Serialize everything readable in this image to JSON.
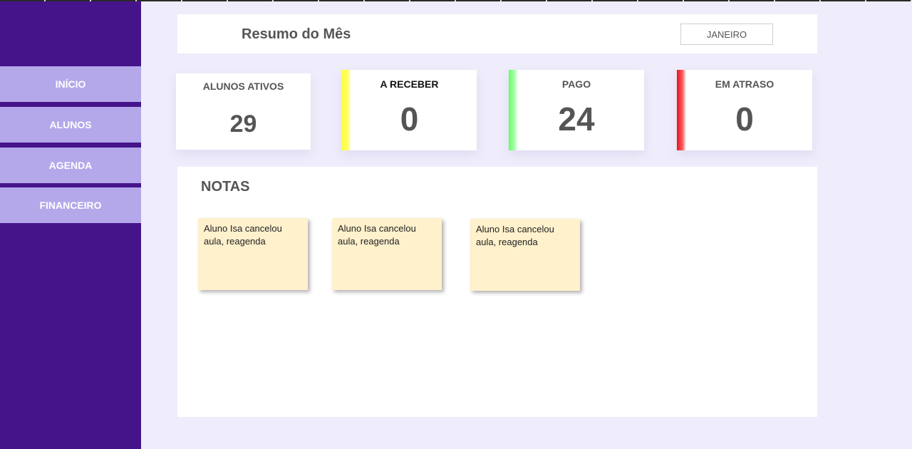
{
  "sidebar": {
    "items": [
      {
        "label": "INÍCIO"
      },
      {
        "label": "ALUNOS"
      },
      {
        "label": "AGENDA"
      },
      {
        "label": "FINANCEIRO"
      }
    ]
  },
  "header": {
    "title": "Resumo do Mês",
    "month": "JANEIRO"
  },
  "cards": [
    {
      "label": "ALUNOS ATIVOS",
      "value": "29"
    },
    {
      "label": "A RECEBER",
      "value": "0",
      "accent": "#ffff33"
    },
    {
      "label": "PAGO",
      "value": "24",
      "accent": "#7dff7d"
    },
    {
      "label": "EM ATRASO",
      "value": "0",
      "accent": "#e8141c"
    }
  ],
  "notes": {
    "title": "NOTAS",
    "items": [
      {
        "text": "Aluno Isa cancelou aula, reagenda"
      },
      {
        "text": "Aluno Isa cancelou aula, reagenda"
      },
      {
        "text": "Aluno Isa cancelou aula, reagenda"
      }
    ]
  }
}
